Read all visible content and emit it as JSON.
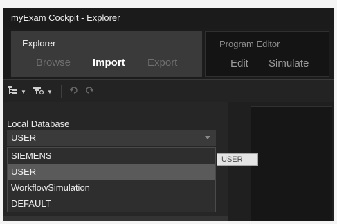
{
  "window": {
    "title": "myExam Cockpit - Explorer"
  },
  "ribbon": {
    "groups": [
      {
        "title": "Explorer",
        "active": true,
        "tabs": [
          {
            "label": "Browse",
            "selected": false
          },
          {
            "label": "Import",
            "selected": true
          },
          {
            "label": "Export",
            "selected": false
          }
        ]
      },
      {
        "title": "Program Editor",
        "active": false,
        "tabs": [
          {
            "label": "Edit",
            "selected": false
          },
          {
            "label": "Simulate",
            "selected": false
          }
        ]
      }
    ]
  },
  "toolbar": {
    "buttons": [
      {
        "icon": "tree-view-icon",
        "has_dropdown": true
      },
      {
        "icon": "filter-icon",
        "has_dropdown": true
      },
      {
        "icon": "undo-icon",
        "has_dropdown": false
      },
      {
        "icon": "redo-icon",
        "has_dropdown": false
      }
    ]
  },
  "local_database": {
    "label": "Local Database",
    "selected_value": "USER",
    "options": [
      "SIEMENS",
      "USER",
      "WorkflowSimulation",
      "DEFAULT"
    ],
    "highlighted_option": "USER"
  },
  "tooltip": {
    "text": "USER"
  },
  "colors": {
    "background": "#232323",
    "ribbon_active": "#3a3a3a",
    "highlight": "#5a5a5a",
    "text": "#ececec",
    "text_inactive": "#6f6f6f"
  }
}
